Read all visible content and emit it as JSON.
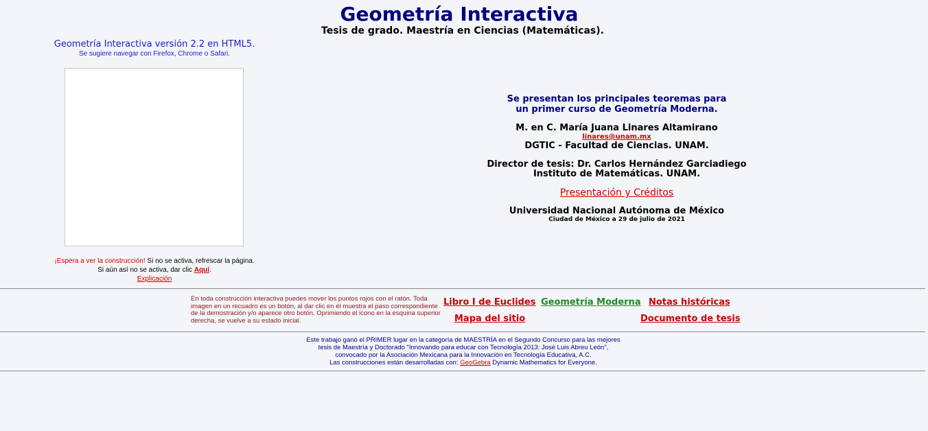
{
  "header": {
    "title": "Geometría Interactiva",
    "subtitle": "Tesis de grado. Maestría en Ciencias (Matemáticas)."
  },
  "left_panel": {
    "version": "Geometría Interactiva versión 2.2 en HTML5.",
    "browser_hint": "Se sugiere navegar con Firefox, Chrome o Safari.",
    "wait_red": "¡Espera a ver la construcción!",
    "wait_rest": " Si no se activa, refrescar la página.",
    "click_prefix": "Si aún así no se activa, dar clic ",
    "click_link": "Aquí",
    "click_suffix": ".",
    "explanation_link": "Explicación"
  },
  "info": {
    "intro_line1": "Se presentan los principales teoremas para",
    "intro_line2": "un primer curso de Geometría Moderna.",
    "author": "M. en C. María Juana Linares Altamirano",
    "email": "linares@unam.mx",
    "affiliation": "DGTIC - Facultad de Ciencias. UNAM.",
    "director": "Director de tesis: Dr. Carlos Hernández Garciadiego",
    "institute": "Instituto de Matemáticas. UNAM.",
    "presentation_link": "Presentación y Créditos",
    "university": "Universidad Nacional Autónoma de México",
    "date": "Ciudad de México a 29 de julio de 2021"
  },
  "note": {
    "text": "En toda construcción interactiva puedes mover los puntos rojos con el ratón. Toda imagen en un recuadro es un botón, al dar clic en él muestra el paso correspondiente de la demostración y/o aparece otro botón. Oprimiendo el icono en la esquina superior derecha, se vuelve a su estado inicial."
  },
  "nav": {
    "euclid": "Libro I de Euclides",
    "modern": "Geometría Moderna",
    "history": "Notas históricas",
    "sitemap": "Mapa del sitio",
    "thesis_doc": "Documento de tesis"
  },
  "footer": {
    "line1": "Este trabajo ganó el PRIMER lugar en la categoría de MAESTRÍA en el Segundo Concurso para las mejores",
    "line2": "tesis de Maestría y Doctorado \"Innovando para educar con Tecnología 2013: José Luis Abreu León\",",
    "line3": "convocado por la Asociación Mexicana para la Innovación en Tecnología Educativa, A.C.",
    "line4_prefix": "Las construcciones están desarrolladas con: ",
    "geogebra_link": "GeoGebra",
    "line4_suffix": " Dynamic Mathematics for Everyone."
  },
  "colors": {
    "title_blue": "#000080",
    "link_red": "#cc0000",
    "link_green": "#228B22",
    "background": "#f4f5f9"
  }
}
